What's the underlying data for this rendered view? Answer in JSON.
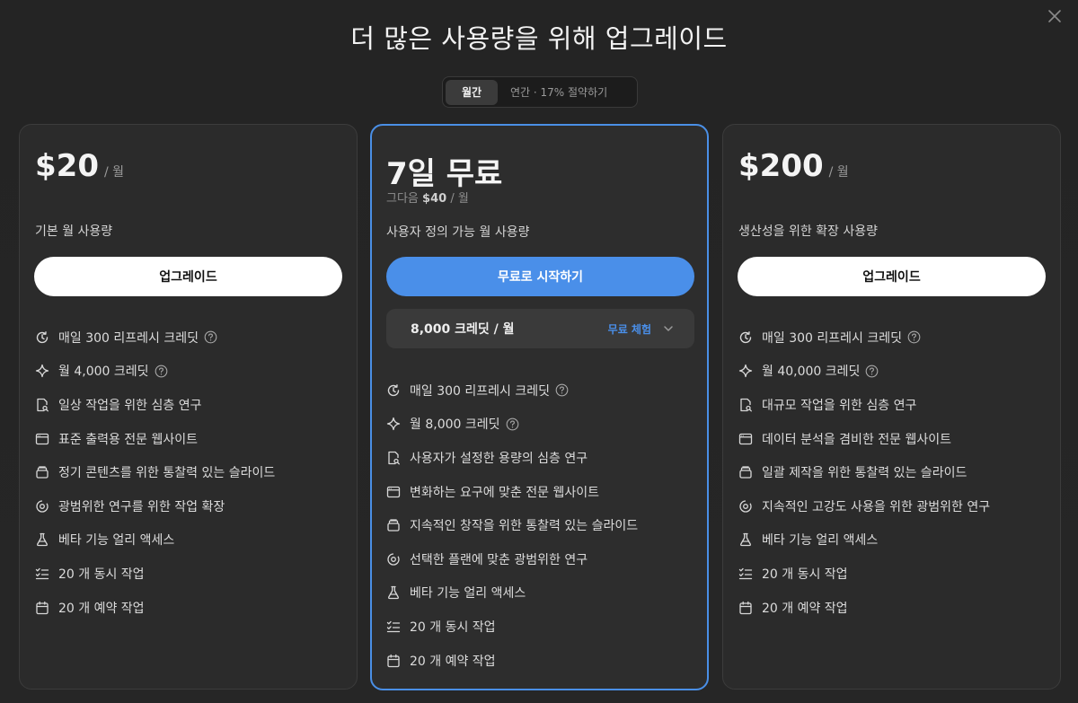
{
  "header": {
    "title": "더 많은 사용량을 위해 업그레이드"
  },
  "billing_toggle": {
    "monthly": "월간",
    "yearly": "연간 · 17% 절약하기"
  },
  "plans": [
    {
      "price": "$20",
      "period": "/ 월",
      "description": "기본 월 사용량",
      "cta": "업그레이드",
      "features": [
        {
          "text": "매일 300 리프레시 크레딧",
          "icon": "refresh-icon",
          "help": true
        },
        {
          "text": "월 4,000 크레딧",
          "icon": "sparkle-icon",
          "help": true
        },
        {
          "text": "일상 작업을 위한 심층 연구",
          "icon": "doc-search-icon"
        },
        {
          "text": "표준 출력용 전문 웹사이트",
          "icon": "browser-icon"
        },
        {
          "text": "정기 콘텐츠를 위한 통찰력 있는 슬라이드",
          "icon": "slides-icon"
        },
        {
          "text": "광범위한 연구를 위한 작업 확장",
          "icon": "expand-icon"
        },
        {
          "text": "베타 기능 얼리 액세스",
          "icon": "flask-icon"
        },
        {
          "text": "20 개 동시 작업",
          "icon": "checklist-icon"
        },
        {
          "text": "20 개 예약 작업",
          "icon": "calendar-icon"
        }
      ]
    },
    {
      "price": "7일 무료",
      "after_prefix": "그다음",
      "after_price": "$40",
      "after_period": "/ 월",
      "description": "사용자 정의 가능 월 사용량",
      "cta": "무료로 시작하기",
      "credit_option": "8,000 크레딧 / 월",
      "credit_badge": "무료 체험",
      "features": [
        {
          "text": "매일 300 리프레시 크레딧",
          "icon": "refresh-icon",
          "help": true
        },
        {
          "text": "월 8,000 크레딧",
          "icon": "sparkle-icon",
          "help": true
        },
        {
          "text": "사용자가 설정한 용량의 심층 연구",
          "icon": "doc-search-icon"
        },
        {
          "text": "변화하는 요구에 맞춘 전문 웹사이트",
          "icon": "browser-icon"
        },
        {
          "text": "지속적인 창작을 위한 통찰력 있는 슬라이드",
          "icon": "slides-icon"
        },
        {
          "text": "선택한 플랜에 맞춘 광범위한 연구",
          "icon": "expand-icon"
        },
        {
          "text": "베타 기능 얼리 액세스",
          "icon": "flask-icon"
        },
        {
          "text": "20 개 동시 작업",
          "icon": "checklist-icon"
        },
        {
          "text": "20 개 예약 작업",
          "icon": "calendar-icon"
        }
      ]
    },
    {
      "price": "$200",
      "period": "/ 월",
      "description": "생산성을 위한 확장 사용량",
      "cta": "업그레이드",
      "features": [
        {
          "text": "매일 300 리프레시 크레딧",
          "icon": "refresh-icon",
          "help": true
        },
        {
          "text": "월 40,000 크레딧",
          "icon": "sparkle-icon",
          "help": true
        },
        {
          "text": "대규모 작업을 위한 심층 연구",
          "icon": "doc-search-icon"
        },
        {
          "text": "데이터 분석을 겸비한 전문 웹사이트",
          "icon": "browser-icon"
        },
        {
          "text": "일괄 제작을 위한 통찰력 있는 슬라이드",
          "icon": "slides-icon"
        },
        {
          "text": "지속적인 고강도 사용을 위한 광범위한 연구",
          "icon": "expand-icon"
        },
        {
          "text": "베타 기능 얼리 액세스",
          "icon": "flask-icon"
        },
        {
          "text": "20 개 동시 작업",
          "icon": "checklist-icon"
        },
        {
          "text": "20 개 예약 작업",
          "icon": "calendar-icon"
        }
      ]
    }
  ],
  "colors": {
    "accent": "#4a8fe9",
    "background": "#242424",
    "card": "#2b2b2b"
  }
}
